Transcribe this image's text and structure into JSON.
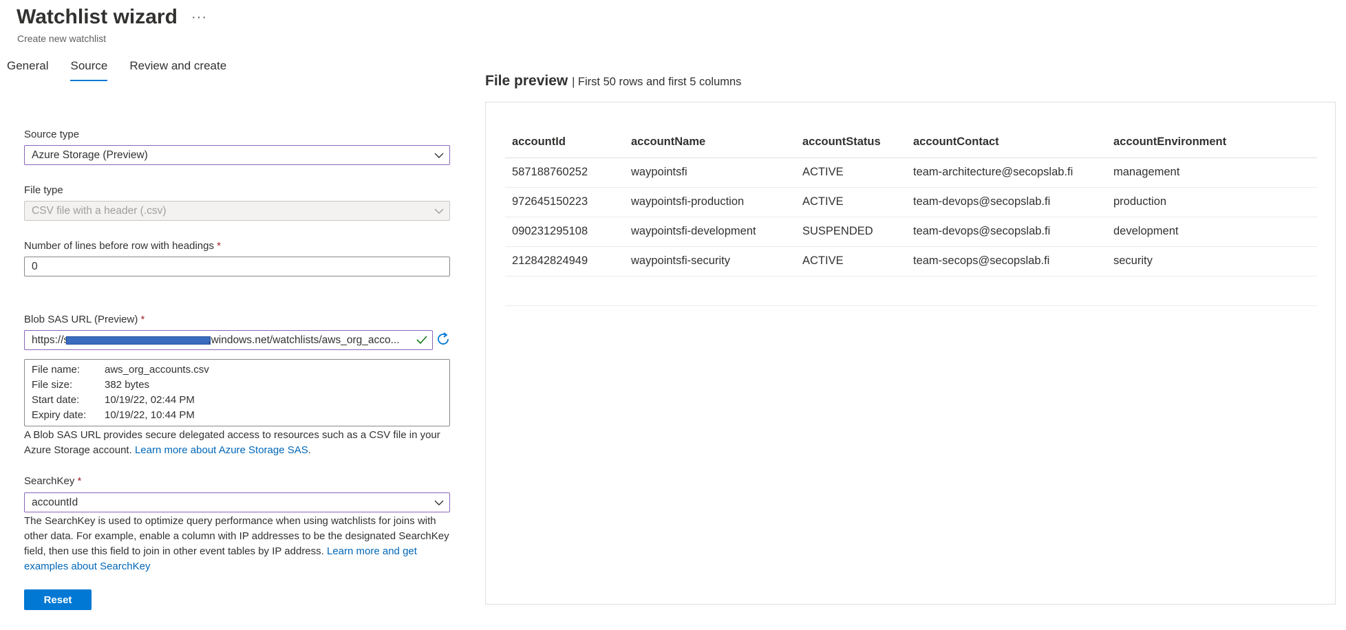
{
  "header": {
    "title": "Watchlist wizard",
    "more": "···",
    "subtitle": "Create new watchlist"
  },
  "tabs": [
    {
      "label": "General",
      "active": false
    },
    {
      "label": "Source",
      "active": true
    },
    {
      "label": "Review and create",
      "active": false
    }
  ],
  "form": {
    "source_type": {
      "label": "Source type",
      "value": "Azure Storage (Preview)"
    },
    "file_type": {
      "label": "File type",
      "value": "CSV file with a header (.csv)"
    },
    "lines_before": {
      "label": "Number of lines before row with headings",
      "required_mark": "*",
      "value": "0"
    },
    "blob_sas": {
      "label": "Blob SAS URL (Preview)",
      "required_mark": "*",
      "value_prefix": "https://s",
      "value_suffix": ".windows.net/watchlists/aws_org_acco..."
    },
    "file_info": [
      {
        "key": "File name:",
        "value": "aws_org_accounts.csv"
      },
      {
        "key": "File size:",
        "value": "382 bytes"
      },
      {
        "key": "Start date:",
        "value": "10/19/22, 02:44 PM"
      },
      {
        "key": "Expiry date:",
        "value": "10/19/22, 10:44 PM"
      }
    ],
    "sas_help": "A Blob SAS URL provides secure delegated access to resources such as a CSV file in your Azure Storage account.",
    "sas_help_link": "Learn more about Azure Storage SAS",
    "search_key": {
      "label": "SearchKey",
      "required_mark": "*",
      "value": "accountId"
    },
    "search_key_help": "The SearchKey is used to optimize query performance when using watchlists for joins with other data. For example, enable a column with IP addresses to be the designated SearchKey field, then use this field to join in other event tables by IP address.",
    "search_key_link": "Learn more and get examples about SearchKey",
    "reset_label": "Reset"
  },
  "preview": {
    "title": "File preview",
    "subtitle": "| First 50 rows and first 5 columns",
    "columns": [
      "accountId",
      "accountName",
      "accountStatus",
      "accountContact",
      "accountEnvironment"
    ],
    "rows": [
      [
        "587188760252",
        "waypointsfi",
        "ACTIVE",
        "team-architecture@secopslab.fi",
        "management"
      ],
      [
        "972645150223",
        "waypointsfi-production",
        "ACTIVE",
        "team-devops@secopslab.fi",
        "production"
      ],
      [
        "090231295108",
        "waypointsfi-development",
        "SUSPENDED",
        "team-devops@secopslab.fi",
        "development"
      ],
      [
        "212842824949",
        "waypointsfi-security",
        "ACTIVE",
        "team-secops@secopslab.fi",
        "security"
      ]
    ]
  },
  "colors": {
    "accent": "#0078d4",
    "focus_border": "#8764b8",
    "success": "#107c10",
    "link": "#0067b8",
    "required": "#a4262c"
  },
  "icons": {
    "more": "ellipsis-icon",
    "dropdown": "chevron-down-icon",
    "valid": "checkmark-icon",
    "refresh": "refresh-icon"
  }
}
